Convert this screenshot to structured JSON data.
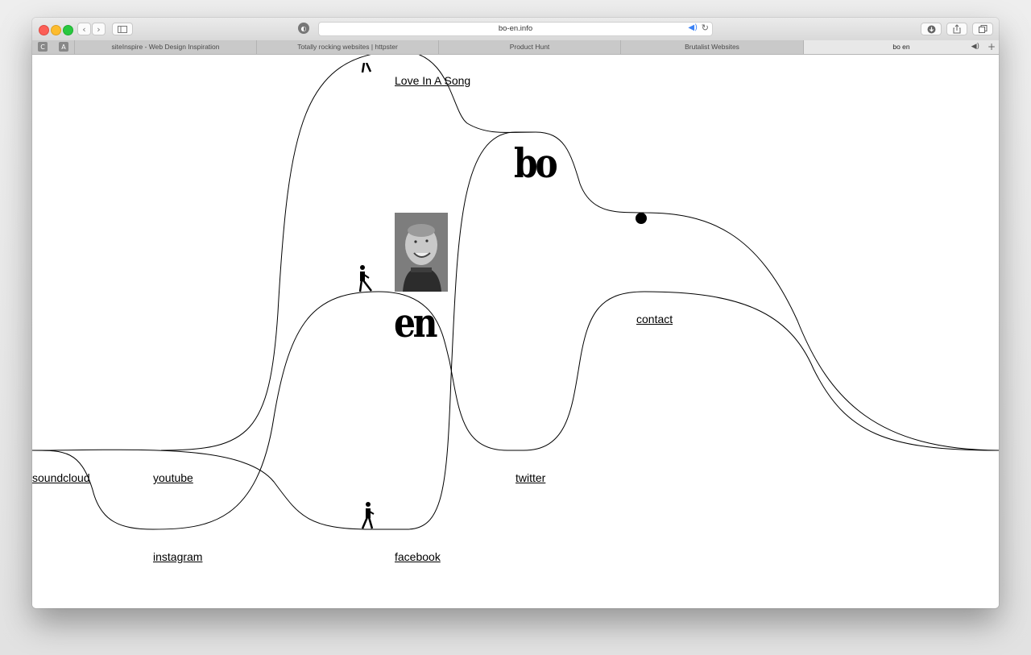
{
  "browser": {
    "address": "bo-en.info",
    "pinned": [
      "C",
      "A"
    ],
    "tabs": [
      {
        "label": "siteInspire - Web Design Inspiration"
      },
      {
        "label": "Totally rocking websites | httpster"
      },
      {
        "label": "Product Hunt"
      },
      {
        "label": "Brutalist Websites"
      },
      {
        "label": "bo en"
      }
    ],
    "audio_icon": "speaker-icon",
    "colors": {
      "red": "#fc5f57",
      "yellow": "#fdbc2e",
      "green": "#29c840",
      "audio": "#3b82f6"
    }
  },
  "site": {
    "logo_top": "bo",
    "logo_bottom": "en",
    "links": {
      "song": "Love In A Song",
      "soundcloud": "soundcloud",
      "youtube": "youtube",
      "instagram": "instagram",
      "facebook": "facebook",
      "twitter": "twitter",
      "contact": "contact"
    },
    "photo_alt": "portrait photo",
    "icons": [
      "walking-person-icon",
      "circle-dot-icon"
    ]
  }
}
